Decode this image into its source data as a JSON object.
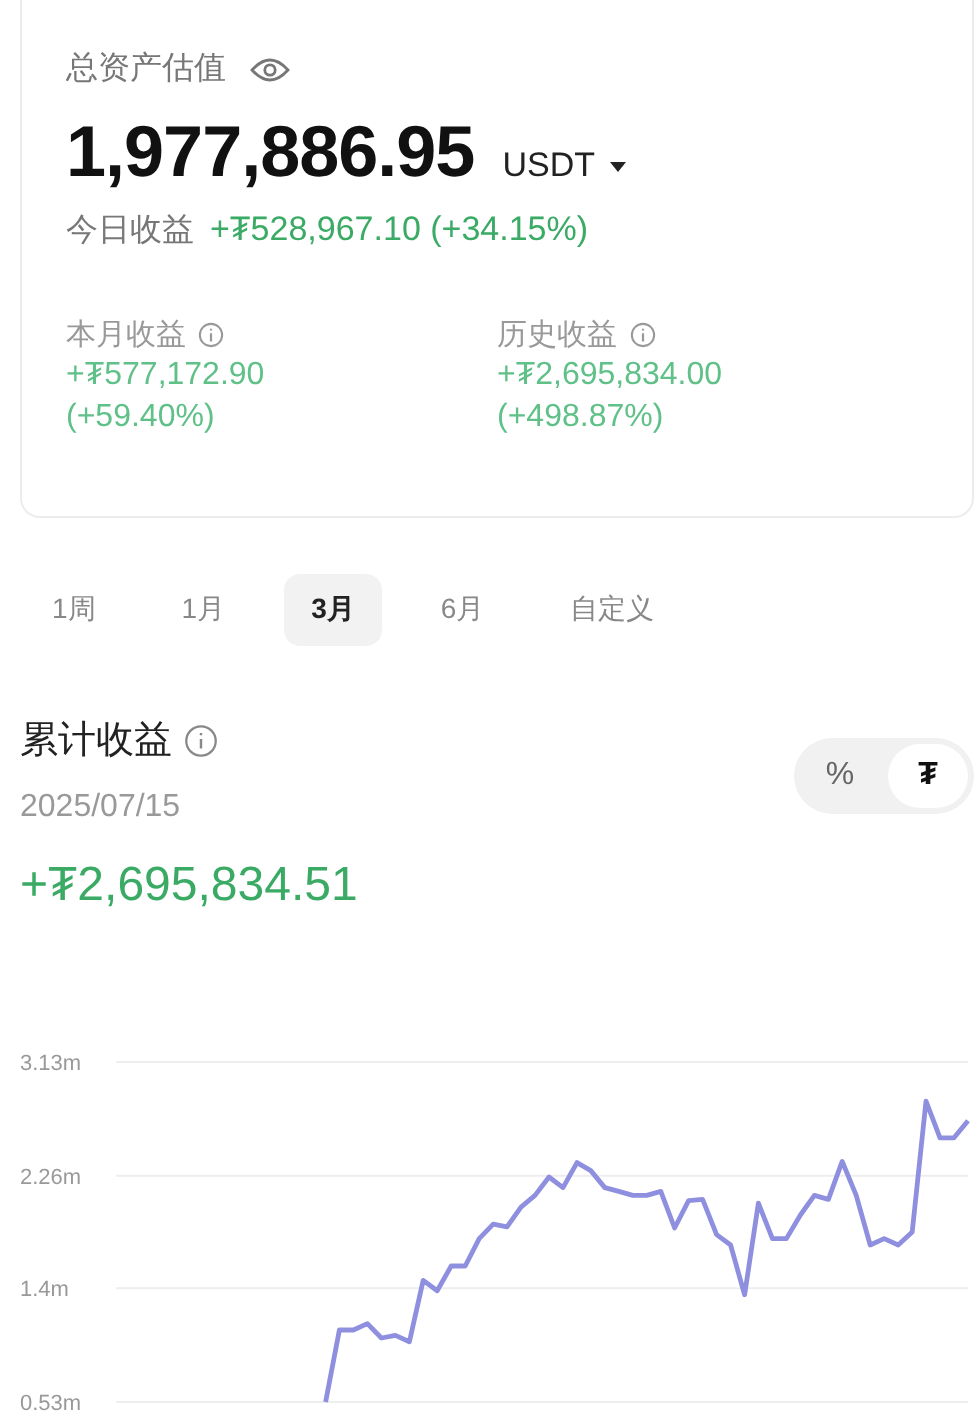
{
  "summary": {
    "title": "总资产估值",
    "amount": "1,977,886.95",
    "currency": "USDT",
    "today_label": "今日收益",
    "today_value": "+₮528,967.10 (+34.15%)",
    "stats": [
      {
        "label": "本月收益",
        "value": "+₮577,172.90",
        "percent": "(+59.40%)"
      },
      {
        "label": "历史收益",
        "value": "+₮2,695,834.00",
        "percent": "(+498.87%)"
      }
    ]
  },
  "periods": [
    {
      "label": "1周",
      "selected": false
    },
    {
      "label": "1月",
      "selected": false
    },
    {
      "label": "3月",
      "selected": true
    },
    {
      "label": "6月",
      "selected": false
    },
    {
      "label": "自定义",
      "selected": false
    }
  ],
  "cumulative": {
    "title": "累计收益",
    "date": "2025/07/15",
    "value": "+₮2,695,834.51",
    "toggle": [
      {
        "label": "%",
        "selected": false
      },
      {
        "label": "₮",
        "selected": true
      }
    ],
    "chart_data": {
      "type": "line",
      "grid": true,
      "ylim": [
        0.53,
        3.13
      ],
      "categories": [
        null,
        null,
        null,
        null,
        null,
        null,
        null,
        null,
        null,
        null,
        null,
        null,
        null,
        null,
        null,
        null,
        null,
        null,
        null,
        null,
        null,
        null,
        null,
        null,
        null,
        null,
        null,
        null,
        null,
        null,
        null,
        null,
        null,
        null,
        null,
        null,
        null,
        null,
        null,
        null,
        null,
        null,
        null,
        null,
        null,
        null,
        null,
        null,
        null,
        null,
        null,
        null,
        null,
        null,
        null,
        null,
        null,
        null,
        null,
        null,
        null,
        null
      ],
      "yticks": [
        {
          "value": 0.53,
          "label": "0.53m"
        },
        {
          "value": 1.4,
          "label": "1.4m"
        },
        {
          "value": 2.26,
          "label": "2.26m"
        },
        {
          "value": 3.13,
          "label": "3.13m"
        }
      ],
      "series": [
        {
          "color": "#8f8fe0",
          "values": [
            null,
            null,
            null,
            null,
            null,
            null,
            null,
            null,
            null,
            null,
            null,
            null,
            null,
            null,
            null,
            0.53,
            1.08,
            1.08,
            1.13,
            1.02,
            1.04,
            0.99,
            1.46,
            1.38,
            1.57,
            1.57,
            1.78,
            1.89,
            1.87,
            2.02,
            2.11,
            2.25,
            2.17,
            2.36,
            2.3,
            2.17,
            2.14,
            2.11,
            2.11,
            2.14,
            1.86,
            2.07,
            2.08,
            1.81,
            1.73,
            1.35,
            2.05,
            1.78,
            1.78,
            1.96,
            2.11,
            2.08,
            2.37,
            2.11,
            1.73,
            1.78,
            1.73,
            1.83,
            2.83,
            2.55,
            2.55,
            2.68
          ]
        }
      ]
    }
  }
}
